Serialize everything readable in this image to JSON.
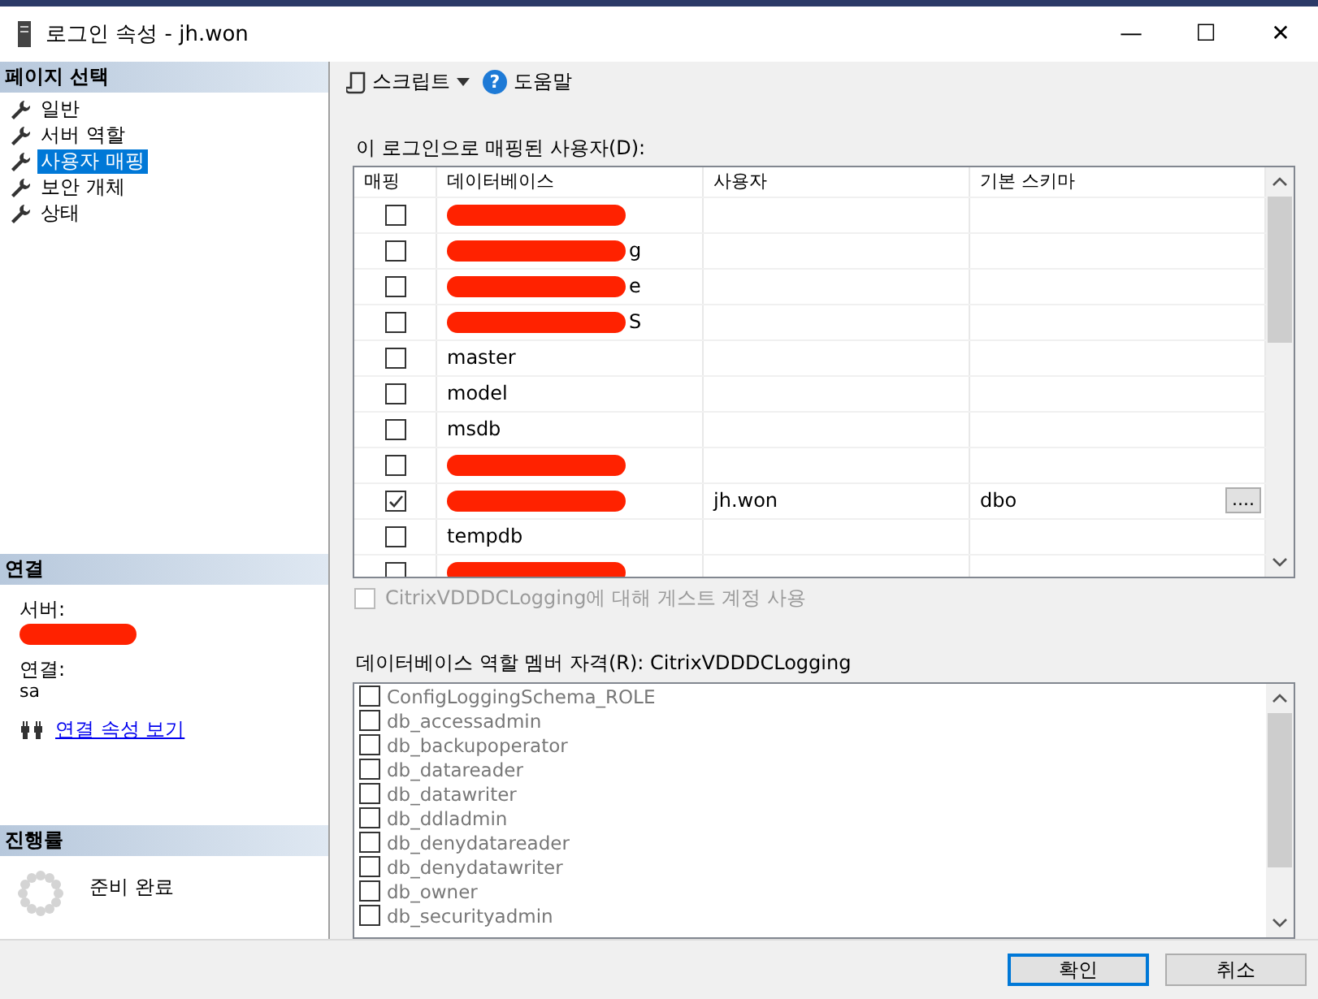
{
  "window": {
    "title": "로그인 속성 - jh.won",
    "controls": {
      "minimize": "—",
      "maximize": "☐",
      "close": "✕"
    }
  },
  "sidebar": {
    "header": "페이지 선택",
    "items": [
      {
        "label": "일반",
        "selected": false
      },
      {
        "label": "서버 역할",
        "selected": false
      },
      {
        "label": "사용자 매핑",
        "selected": true
      },
      {
        "label": "보안 개체",
        "selected": false
      },
      {
        "label": "상태",
        "selected": false
      }
    ]
  },
  "connection": {
    "header": "연결",
    "server_label": "서버:",
    "server_redacted": true,
    "connection_label": "연결:",
    "connection_value": "sa",
    "link": "연결 속성 보기"
  },
  "progress": {
    "header": "진행률",
    "status": "준비 완료"
  },
  "toolbar": {
    "script": "스크립트",
    "help_icon": "?",
    "help": "도움말"
  },
  "mapping": {
    "label": "이 로그인으로 매핑된 사용자(D):",
    "columns": [
      "매핑",
      "데이터베이스",
      "사용자",
      "기본 스키마"
    ],
    "rows": [
      {
        "mapped": false,
        "redacted": true,
        "database": "",
        "user": "",
        "schema": ""
      },
      {
        "mapped": false,
        "redacted": true,
        "database": "g",
        "user": "",
        "schema": ""
      },
      {
        "mapped": false,
        "redacted": true,
        "database": "e",
        "user": "",
        "schema": ""
      },
      {
        "mapped": false,
        "redacted": true,
        "database": "S",
        "user": "",
        "schema": ""
      },
      {
        "mapped": false,
        "redacted": false,
        "database": "master",
        "user": "",
        "schema": ""
      },
      {
        "mapped": false,
        "redacted": false,
        "database": "model",
        "user": "",
        "schema": ""
      },
      {
        "mapped": false,
        "redacted": false,
        "database": "msdb",
        "user": "",
        "schema": ""
      },
      {
        "mapped": false,
        "redacted": true,
        "database": "",
        "user": "",
        "schema": ""
      },
      {
        "mapped": true,
        "redacted": true,
        "database": "",
        "user": "jh.won",
        "schema": "dbo",
        "schema_button": "...."
      },
      {
        "mapped": false,
        "redacted": false,
        "database": "tempdb",
        "user": "",
        "schema": ""
      },
      {
        "mapped": false,
        "redacted": true,
        "database": "",
        "user": "",
        "schema": ""
      }
    ]
  },
  "guest": {
    "label": "CitrixVDDDCLogging에 대해 게스트 계정 사용",
    "checked": false,
    "disabled": true
  },
  "roles": {
    "label": "데이터베이스 역할 멤버 자격(R): CitrixVDDDCLogging",
    "disabled": true,
    "items": [
      {
        "label": "ConfigLoggingSchema_ROLE",
        "checked": false
      },
      {
        "label": "db_accessadmin",
        "checked": false
      },
      {
        "label": "db_backupoperator",
        "checked": false
      },
      {
        "label": "db_datareader",
        "checked": false
      },
      {
        "label": "db_datawriter",
        "checked": false
      },
      {
        "label": "db_ddladmin",
        "checked": false
      },
      {
        "label": "db_denydatareader",
        "checked": false
      },
      {
        "label": "db_denydatawriter",
        "checked": false
      },
      {
        "label": "db_owner",
        "checked": false
      },
      {
        "label": "db_securityadmin",
        "checked": false
      }
    ]
  },
  "buttons": [
    {
      "label": "확인",
      "default": true
    },
    {
      "label": "취소",
      "default": false
    }
  ]
}
